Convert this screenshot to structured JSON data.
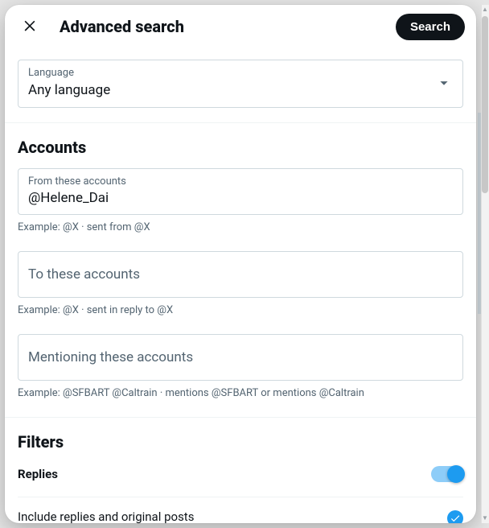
{
  "header": {
    "title": "Advanced search",
    "search_button": "Search"
  },
  "language": {
    "label": "Language",
    "value": "Any language"
  },
  "accounts": {
    "title": "Accounts",
    "from": {
      "label": "From these accounts",
      "value": "@Helene_Dai",
      "helper": "Example: @X · sent from @X"
    },
    "to": {
      "placeholder": "To these accounts",
      "helper": "Example: @X · sent in reply to @X"
    },
    "mentioning": {
      "placeholder": "Mentioning these accounts",
      "helper": "Example: @SFBART @Caltrain · mentions @SFBART or mentions @Caltrain"
    }
  },
  "filters": {
    "title": "Filters",
    "replies": {
      "label": "Replies",
      "on": true,
      "option1": "Include replies and original posts"
    }
  }
}
